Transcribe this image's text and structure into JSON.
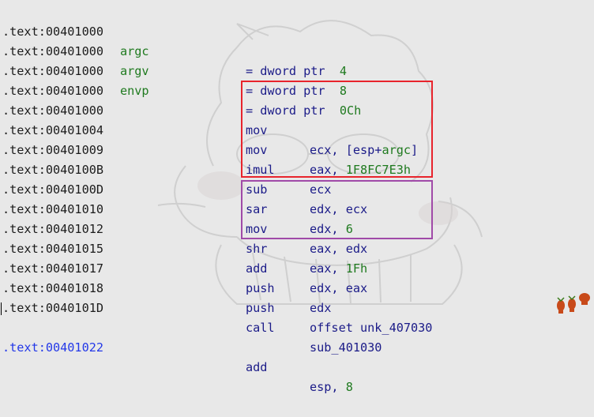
{
  "window": {
    "background": "#e8e8e8",
    "address_color": "#1c1c1c",
    "current_address_color": "#2338e8",
    "mnemonic_color": "#1b1b88",
    "number_color": "#1f7a1f",
    "highlight_colors": [
      "#e8242c",
      "#a04aa8"
    ],
    "background_art": "cartoon-character-watermark",
    "corner_logo": "red-bug-logo"
  },
  "header_lines": [
    {
      "address": ".text:00401000",
      "name": "argc",
      "eq": "= dword ptr",
      "value": "4"
    },
    {
      "address": ".text:00401000",
      "name": "argv",
      "eq": "= dword ptr",
      "value": "8"
    },
    {
      "address": ".text:00401000",
      "name": "envp",
      "eq": "= dword ptr",
      "value": "0Ch"
    },
    {
      "address": ".text:00401000"
    }
  ],
  "instructions": [
    {
      "address": ".text:00401000",
      "mnemonic": "mov",
      "op1": "ecx, [esp+",
      "op_arg": "argc",
      "op_tail": "]",
      "op_num": ""
    },
    {
      "address": ".text:00401004",
      "mnemonic": "mov",
      "op1": "eax, ",
      "op_arg": "",
      "op_tail": "",
      "op_num": "1F8FC7E3h"
    },
    {
      "address": ".text:00401009",
      "mnemonic": "imul",
      "op1": "ecx",
      "op_arg": "",
      "op_tail": "",
      "op_num": ""
    },
    {
      "address": ".text:0040100B",
      "mnemonic": "sub",
      "op1": "edx, ecx",
      "op_arg": "",
      "op_tail": "",
      "op_num": ""
    },
    {
      "address": ".text:0040100D",
      "mnemonic": "sar",
      "op1": "edx, ",
      "op_arg": "",
      "op_tail": "",
      "op_num": "6"
    },
    {
      "address": ".text:00401010",
      "mnemonic": "mov",
      "op1": "eax, edx",
      "op_arg": "",
      "op_tail": "",
      "op_num": ""
    },
    {
      "address": ".text:00401012",
      "mnemonic": "shr",
      "op1": "eax, ",
      "op_arg": "",
      "op_tail": "",
      "op_num": "1Fh"
    },
    {
      "address": ".text:00401015",
      "mnemonic": "add",
      "op1": "edx, eax",
      "op_arg": "",
      "op_tail": "",
      "op_num": ""
    },
    {
      "address": ".text:00401017",
      "mnemonic": "push",
      "op1": "edx",
      "op_arg": "",
      "op_tail": "",
      "op_num": ""
    },
    {
      "address": ".text:00401018",
      "mnemonic": "push",
      "op1": "offset unk_407030",
      "op_arg": "",
      "op_tail": "",
      "op_num": ""
    },
    {
      "address": ".text:0040101D",
      "mnemonic": "call",
      "op1": "sub_401030",
      "op_arg": "",
      "op_tail": "",
      "op_num": ""
    },
    {
      "address": ".text:00401022",
      "mnemonic": "add",
      "op1": "esp, ",
      "op_arg": "",
      "op_tail": "",
      "op_num": "8",
      "current": true
    }
  ]
}
